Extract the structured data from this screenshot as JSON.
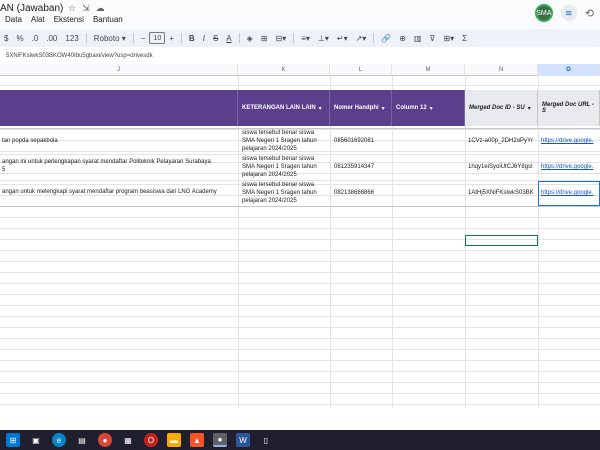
{
  "app": {
    "title": "AN (Jawaban)",
    "menus": [
      "Data",
      "Alat",
      "Ekstensi",
      "Bantuan"
    ],
    "avatar_text": "SMA"
  },
  "toolbar": {
    "currency": "$",
    "percent": "%",
    "dec_decrease": ".0",
    "dec_increase": ".00",
    "number_format": "123",
    "font": "Roboto",
    "font_size": "10",
    "minus": "−",
    "plus": "+",
    "bold": "B",
    "italic": "I",
    "strike": "S",
    "text_color": "A",
    "sigma": "Σ"
  },
  "formula_bar": "5XNiFKslwkS03BKOW40Ibu5gbaxi/view?usp=drivesdk",
  "columns": [
    "J",
    "K",
    "L",
    "M",
    "N",
    "O"
  ],
  "headers": {
    "k": "KETERANGAN LAIN LAIN",
    "l": "Nomer Handphi",
    "m": "Column 12",
    "n": "Merged Doc ID - SU",
    "o": "Merged Doc URL - S"
  },
  "rows": [
    {
      "j": "tan popda sepakbola",
      "k": "siswa tersebut benar siswa SMA Negeri 1 Sragen tahun pelajaran 2024/2025",
      "l": "085601692081",
      "n": "1CVz-a00p_2DH2oPyYr",
      "o": "https://drive.google."
    },
    {
      "j": "angan ini untuk perlengkapan syarat mendaftar Politeknik Pelayaran Surabaya",
      "j2": "5",
      "k": "siswa tersebut benar siswa SMA Negeri 1 Sragen tahun pelajaran 2024/2025",
      "l": "081235914347",
      "n": "1hqy1eiSyoiUtCJ6Y8gsI",
      "o": "https://drive.google."
    },
    {
      "j": "angan untuk melengkapi syarat mendaftar program beasiswa dari LNG Academy",
      "k": "siswa tersebut benar siswa SMA Negeri 1 Sragen tahun pelajaran 2024/2025",
      "l": "082138666866",
      "n": "1AtHj5XNiFKslwkS03BK",
      "o": "https://drive.google."
    }
  ],
  "colors": {
    "header_purple": "#5b3f8c",
    "selection_green": "#0b8043",
    "link_blue": "#1155cc"
  }
}
